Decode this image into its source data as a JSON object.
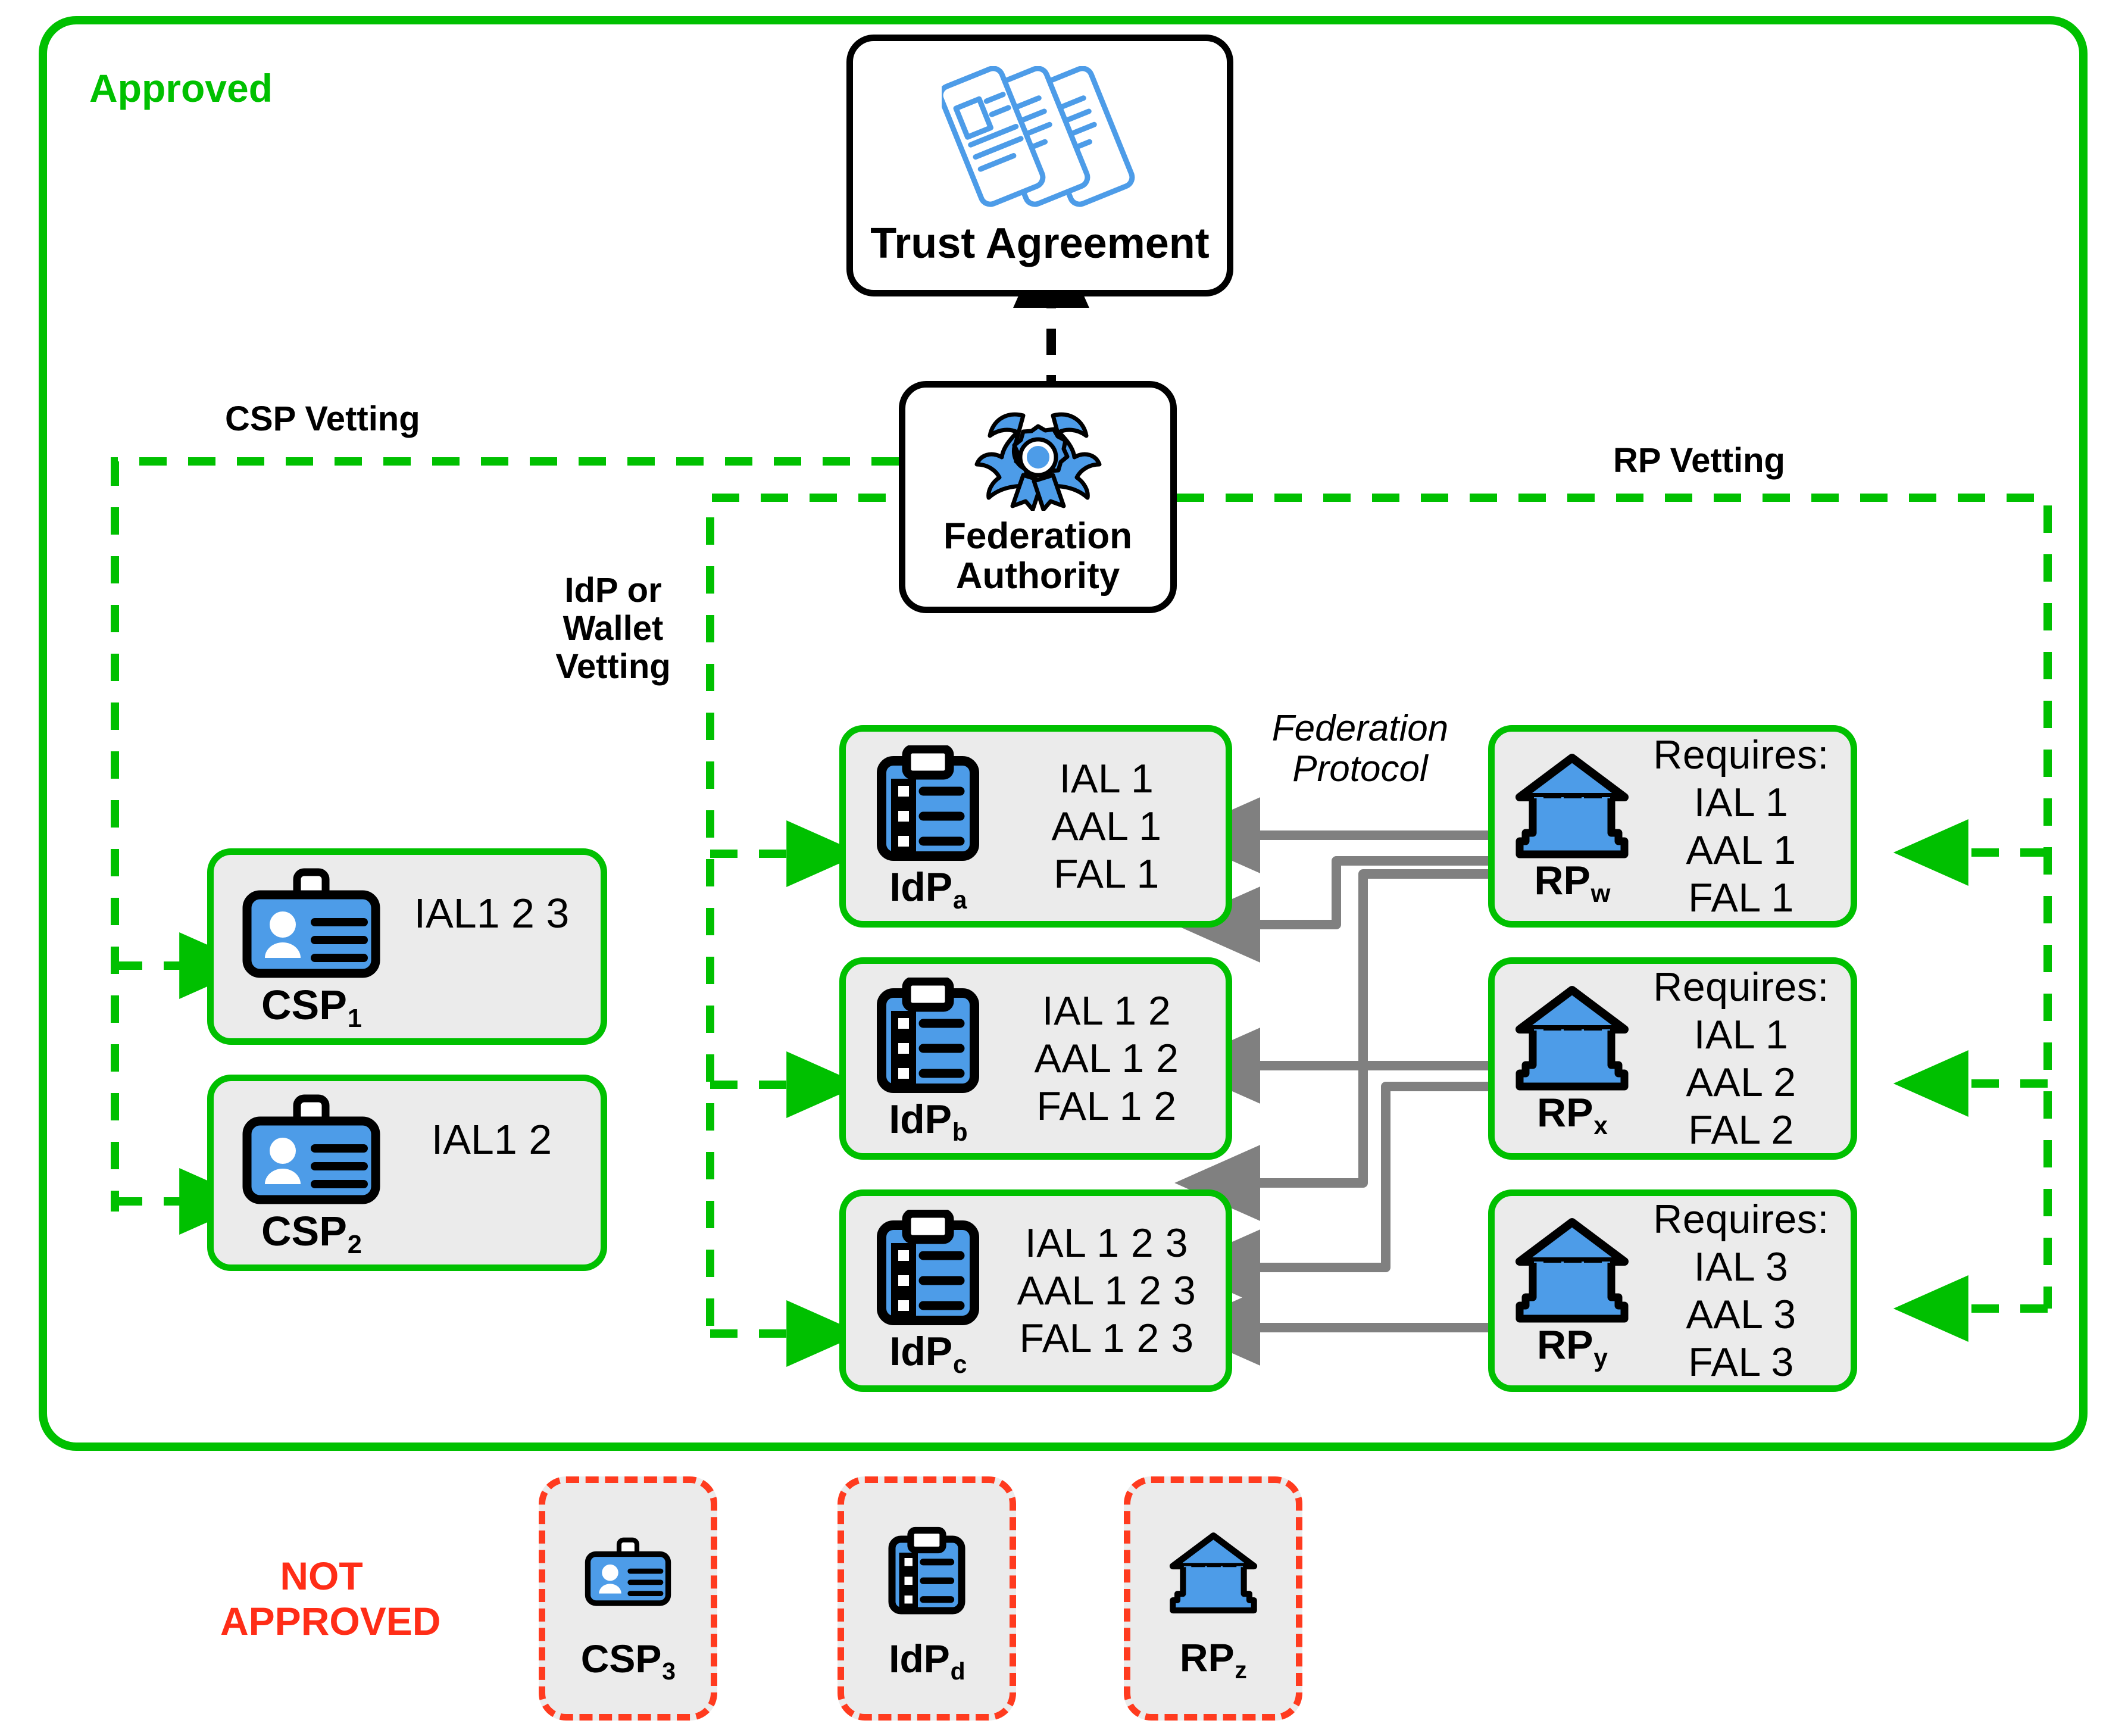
{
  "diagram": {
    "title": "Federation Trust and Vetting Diagram",
    "approved_label": "Approved",
    "not_approved_label": "NOT\nAPPROVED",
    "colors": {
      "approved_green": "#00c000",
      "rejected_red": "#ff3b1f",
      "icon_blue": "#4d9ce8",
      "connector_gray": "#808080",
      "node_fill": "#ebebeb"
    }
  },
  "vetting_labels": {
    "csp": "CSP Vetting",
    "idp": "IdP or\nWallet\nVetting",
    "rp": "RP Vetting",
    "federation_protocol": "Federation\nProtocol"
  },
  "top_nodes": {
    "trust_agreement": {
      "caption": "Trust Agreement",
      "icon": "documents-icon"
    },
    "federation_authority": {
      "caption": "Federation\nAuthority",
      "icon": "award-rosette-icon"
    }
  },
  "csps": [
    {
      "name": "CSP",
      "sub": "1",
      "icon": "id-badge-icon",
      "levels": "IAL1 2 3"
    },
    {
      "name": "CSP",
      "sub": "2",
      "icon": "id-badge-icon",
      "levels": "IAL1 2"
    }
  ],
  "idps": [
    {
      "name": "IdP",
      "sub": "a",
      "icon": "clipboard-checklist-icon",
      "lines": [
        "IAL 1",
        "AAL 1",
        "FAL 1"
      ]
    },
    {
      "name": "IdP",
      "sub": "b",
      "icon": "clipboard-checklist-icon",
      "lines": [
        "IAL 1 2",
        "AAL 1 2",
        "FAL 1 2"
      ]
    },
    {
      "name": "IdP",
      "sub": "c",
      "icon": "clipboard-checklist-icon",
      "lines": [
        "IAL 1 2 3",
        "AAL 1 2 3",
        "FAL 1 2 3"
      ]
    }
  ],
  "rps": [
    {
      "name": "RP",
      "sub": "w",
      "icon": "bank-columns-icon",
      "header": "Requires:",
      "lines": [
        "IAL 1",
        "AAL 1",
        "FAL 1"
      ]
    },
    {
      "name": "RP",
      "sub": "x",
      "icon": "bank-columns-icon",
      "header": "Requires:",
      "lines": [
        "IAL 1",
        "AAL 2",
        "FAL 2"
      ]
    },
    {
      "name": "RP",
      "sub": "y",
      "icon": "bank-columns-icon",
      "header": "Requires:",
      "lines": [
        "IAL 3",
        "AAL 3",
        "FAL 3"
      ]
    }
  ],
  "rejected": [
    {
      "name": "CSP",
      "sub": "3",
      "icon": "id-badge-icon"
    },
    {
      "name": "IdP",
      "sub": "d",
      "icon": "clipboard-checklist-icon"
    },
    {
      "name": "RP",
      "sub": "z",
      "icon": "bank-columns-icon"
    }
  ],
  "connections": {
    "federation_protocol_pairs": [
      {
        "from": "RP_w",
        "to": "IdP_a"
      },
      {
        "from": "RP_w",
        "to": "IdP_b"
      },
      {
        "from": "RP_w",
        "to": "IdP_c"
      },
      {
        "from": "RP_x",
        "to": "IdP_b"
      },
      {
        "from": "RP_x",
        "to": "IdP_c"
      },
      {
        "from": "RP_y",
        "to": "IdP_c"
      }
    ]
  }
}
